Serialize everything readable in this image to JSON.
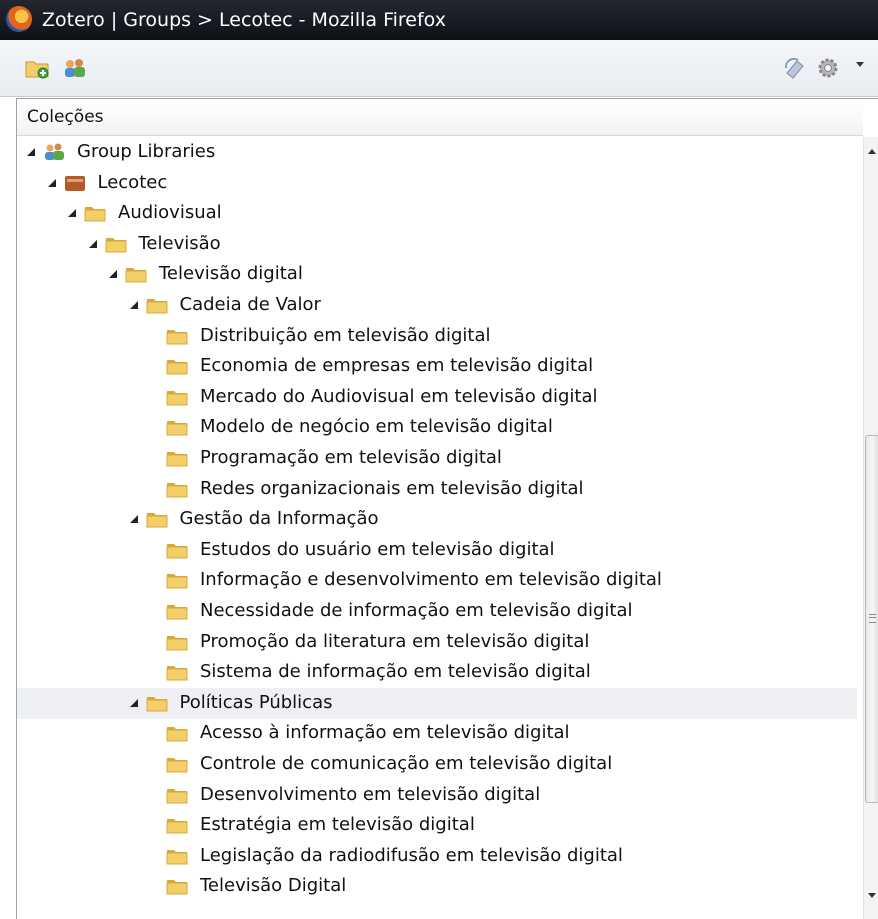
{
  "window": {
    "title": "Zotero | Groups > Lecotec - Mozilla Firefox"
  },
  "toolbar": {
    "icons": [
      "new-collection-icon",
      "new-group-icon",
      "sync-icon",
      "gear-icon",
      "dropdown-arrow-icon"
    ]
  },
  "panel": {
    "header": "Coleções"
  },
  "tree": {
    "rows": [
      {
        "label": "Group Libraries",
        "depth": 0,
        "twisty": true,
        "icon": "group-icon",
        "selected": false
      },
      {
        "label": "Lecotec",
        "depth": 1,
        "twisty": true,
        "icon": "library-icon",
        "selected": false
      },
      {
        "label": "Audiovisual",
        "depth": 2,
        "twisty": true,
        "icon": "folder-icon",
        "selected": false
      },
      {
        "label": "Televisão",
        "depth": 3,
        "twisty": true,
        "icon": "folder-icon",
        "selected": false
      },
      {
        "label": "Televisão digital",
        "depth": 4,
        "twisty": true,
        "icon": "folder-icon",
        "selected": false
      },
      {
        "label": "Cadeia de Valor",
        "depth": 5,
        "twisty": true,
        "icon": "folder-icon",
        "selected": false
      },
      {
        "label": "Distribuição em televisão digital",
        "depth": 6,
        "twisty": false,
        "icon": "folder-icon",
        "selected": false
      },
      {
        "label": "Economia de empresas em televisão digital",
        "depth": 6,
        "twisty": false,
        "icon": "folder-icon",
        "selected": false
      },
      {
        "label": "Mercado do Audiovisual em televisão digital",
        "depth": 6,
        "twisty": false,
        "icon": "folder-icon",
        "selected": false
      },
      {
        "label": "Modelo de negócio em televisão digital",
        "depth": 6,
        "twisty": false,
        "icon": "folder-icon",
        "selected": false
      },
      {
        "label": "Programação em televisão digital",
        "depth": 6,
        "twisty": false,
        "icon": "folder-icon",
        "selected": false
      },
      {
        "label": "Redes organizacionais em televisão digital",
        "depth": 6,
        "twisty": false,
        "icon": "folder-icon",
        "selected": false
      },
      {
        "label": "Gestão da Informação",
        "depth": 5,
        "twisty": true,
        "icon": "folder-icon",
        "selected": false
      },
      {
        "label": "Estudos do usuário em televisão digital",
        "depth": 6,
        "twisty": false,
        "icon": "folder-icon",
        "selected": false
      },
      {
        "label": "Informação e desenvolvimento em televisão digital",
        "depth": 6,
        "twisty": false,
        "icon": "folder-icon",
        "selected": false
      },
      {
        "label": "Necessidade de informação em televisão digital",
        "depth": 6,
        "twisty": false,
        "icon": "folder-icon",
        "selected": false
      },
      {
        "label": "Promoção da literatura em televisão digital",
        "depth": 6,
        "twisty": false,
        "icon": "folder-icon",
        "selected": false
      },
      {
        "label": "Sistema de informação em televisão digital",
        "depth": 6,
        "twisty": false,
        "icon": "folder-icon",
        "selected": false
      },
      {
        "label": "Políticas Públicas",
        "depth": 5,
        "twisty": true,
        "icon": "folder-icon",
        "selected": true
      },
      {
        "label": "Acesso à informação em televisão digital",
        "depth": 6,
        "twisty": false,
        "icon": "folder-icon",
        "selected": false
      },
      {
        "label": "Controle de comunicação em televisão digital",
        "depth": 6,
        "twisty": false,
        "icon": "folder-icon",
        "selected": false
      },
      {
        "label": "Desenvolvimento em televisão digital",
        "depth": 6,
        "twisty": false,
        "icon": "folder-icon",
        "selected": false
      },
      {
        "label": "Estratégia em televisão digital",
        "depth": 6,
        "twisty": false,
        "icon": "folder-icon",
        "selected": false
      },
      {
        "label": "Legislação da radiodifusão em televisão digital",
        "depth": 6,
        "twisty": false,
        "icon": "folder-icon",
        "selected": false
      },
      {
        "label": "Televisão Digital",
        "depth": 6,
        "twisty": false,
        "icon": "folder-icon",
        "selected": false
      }
    ]
  },
  "colors": {
    "folder": "#f2cf69",
    "folder_dark": "#d8a93a",
    "library": "#b45a2a",
    "selection": "#eef0f3"
  }
}
